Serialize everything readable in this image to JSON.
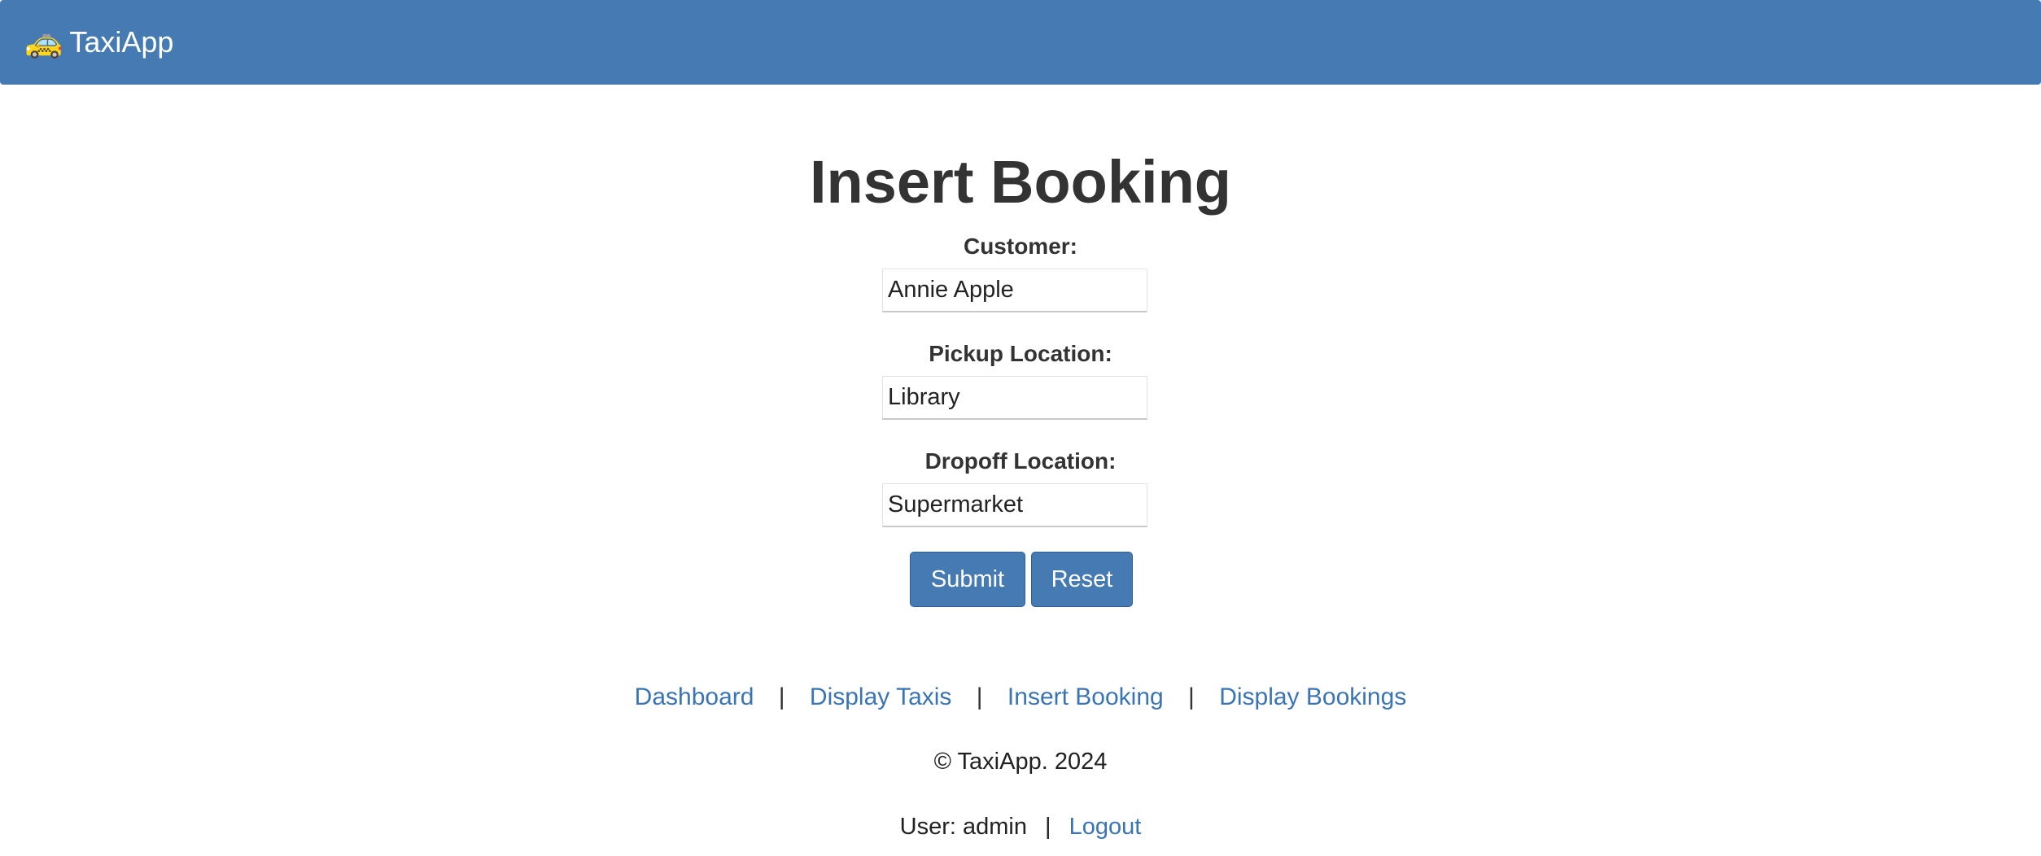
{
  "navbar": {
    "brand_icon": "🚕",
    "brand_label": "TaxiApp",
    "background": "#467ab3"
  },
  "page": {
    "title": "Insert Booking"
  },
  "form": {
    "customer": {
      "label": "Customer:",
      "value": "Annie Apple"
    },
    "pickup": {
      "label": "Pickup Location:",
      "value": "Library"
    },
    "dropoff": {
      "label": "Dropoff Location:",
      "value": "Supermarket"
    },
    "submit_label": "Submit",
    "reset_label": "Reset"
  },
  "footer": {
    "links": [
      {
        "label": "Dashboard"
      },
      {
        "label": "Display Taxis"
      },
      {
        "label": "Insert Booking"
      },
      {
        "label": "Display Bookings"
      }
    ],
    "separator": "|",
    "copyright": "© TaxiApp. 2024",
    "user_text": "User: admin",
    "user_separator": "|",
    "logout_label": "Logout"
  },
  "colors": {
    "accent": "#467ab3",
    "link": "#3a74b5",
    "text": "#333333"
  }
}
